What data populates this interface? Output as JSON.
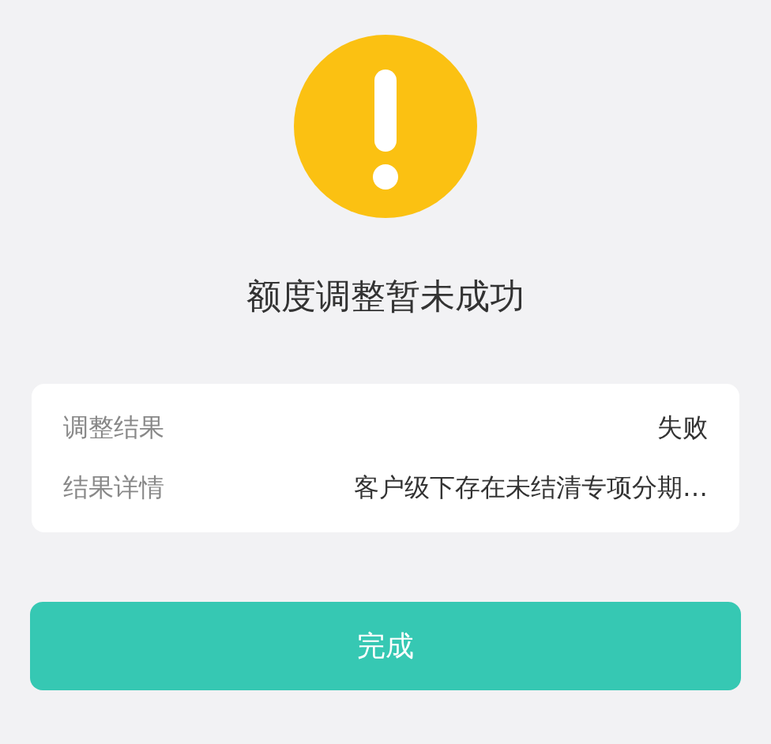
{
  "status_icon": {
    "kind": "warning"
  },
  "title": "额度调整暂未成功",
  "details": [
    {
      "label": "调整结果",
      "value": "失败"
    },
    {
      "label": "结果详情",
      "value": "客户级下存在未结清专项分期…"
    }
  ],
  "button": "完成"
}
